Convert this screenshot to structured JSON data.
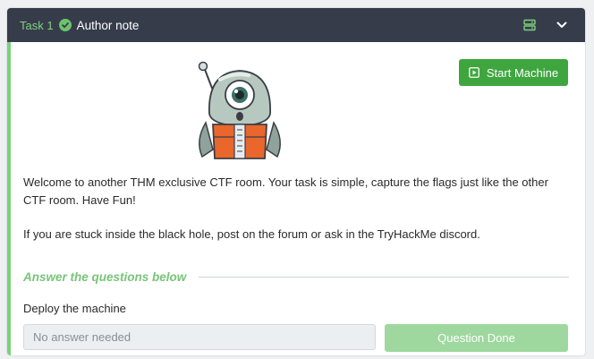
{
  "task": {
    "number_label": "Task 1",
    "title": "Author note",
    "status_icon": "check-circle-icon",
    "header_icons": [
      "server-icon",
      "chevron-down-icon"
    ]
  },
  "machine": {
    "start_label": "Start Machine",
    "start_icon": "play-icon"
  },
  "content": {
    "paragraph1": "Welcome to another THM exclusive CTF room. Your task is simple, capture the flags just like the other CTF room. Have Fun!",
    "paragraph2": "If you are stuck inside the black hole, post on the forum or ask in the TryHackMe discord."
  },
  "answers": {
    "section_title": "Answer the questions below",
    "questions": [
      {
        "text": "Deploy the machine",
        "placeholder": "No answer needed",
        "button_label": "Question Done"
      }
    ]
  },
  "colors": {
    "header_bg": "#373c4b",
    "accent_green": "#3fa63f",
    "light_green": "#9ed89e",
    "task_number": "#7fd17f"
  }
}
